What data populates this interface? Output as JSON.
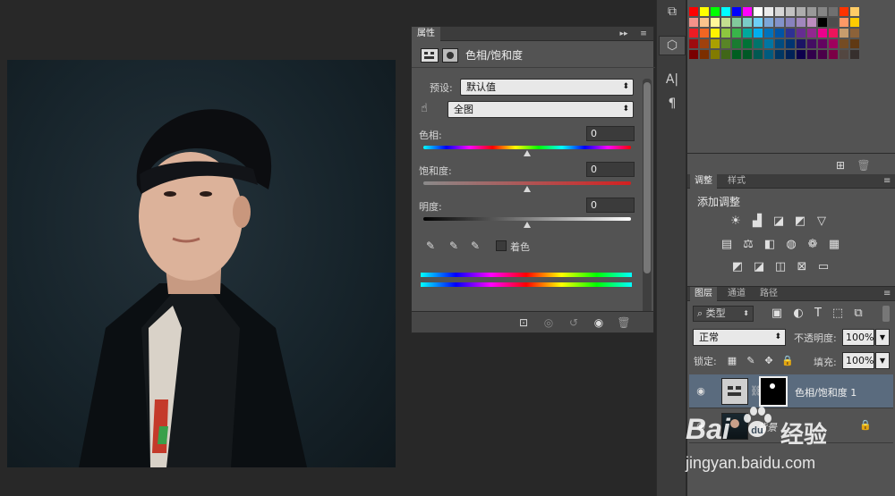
{
  "properties_panel": {
    "tab_label": "属性",
    "menu_collapse": "▸▸",
    "menu_options": "≡",
    "adjustment_title": "色相/饱和度",
    "preset_label": "预设:",
    "preset_value": "默认值",
    "range_value": "全图",
    "hue_label": "色相:",
    "hue_value": "0",
    "saturation_label": "饱和度:",
    "saturation_value": "0",
    "lightness_label": "明度:",
    "lightness_value": "0",
    "colorize_label": "着色",
    "colorize_checked": false,
    "hue_level": 0.5,
    "saturation_level": 0.5,
    "lightness_level": 0.5
  },
  "swatches_panel": {
    "rows": [
      [
        "#ff0000",
        "#ffff00",
        "#00ff00",
        "#00ffff",
        "#0000ff",
        "#ff00ff",
        "#ffffff",
        "#ebebeb",
        "#d6d6d6",
        "#c2c2c2",
        "#adadad",
        "#999999",
        "#858585",
        "#707070",
        "#ff3300",
        "#ffcc66"
      ],
      [
        "#f5928a",
        "#fbc48d",
        "#fff799",
        "#c3df8f",
        "#82ca9c",
        "#7accc8",
        "#6dcff6",
        "#7da7d9",
        "#8393ca",
        "#8882be",
        "#a187be",
        "#bd8cbf",
        "#000000",
        "#4d4d4d",
        "#ff9966",
        "#ffcc00"
      ],
      [
        "#ed1c24",
        "#f26522",
        "#fff200",
        "#8dc63f",
        "#39b54a",
        "#00a99d",
        "#00aeef",
        "#0072bc",
        "#0054a6",
        "#2e3192",
        "#662d91",
        "#92278f",
        "#ec008c",
        "#ed145b",
        "#c69c6d",
        "#8c6239"
      ],
      [
        "#9e0b0f",
        "#a0410d",
        "#aba000",
        "#598527",
        "#197b30",
        "#007236",
        "#00746b",
        "#0076a3",
        "#004b80",
        "#003471",
        "#1b1464",
        "#440e62",
        "#630460",
        "#9e005d",
        "#754c24",
        "#603913"
      ],
      [
        "#790000",
        "#7b2e00",
        "#827b00",
        "#406618",
        "#005e20",
        "#005826",
        "#005952",
        "#005b7f",
        "#003663",
        "#002157",
        "#0d004c",
        "#32004b",
        "#4b0049",
        "#7b0046",
        "#534741",
        "#362f2d"
      ]
    ]
  },
  "adjustments_panel": {
    "tab_adjustments": "调整",
    "tab_styles": "样式",
    "add_adjustment_label": "添加调整"
  },
  "layers_panel": {
    "tab_layers": "图层",
    "tab_channels": "通道",
    "tab_paths": "路径",
    "filter_kind": "类型",
    "blend_mode": "正常",
    "opacity_label": "不透明度:",
    "opacity_value": "100%",
    "lock_label": "锁定:",
    "fill_label": "填充:",
    "fill_value": "100%",
    "layers": [
      {
        "name": "色相/饱和度 1",
        "selected": true
      },
      {
        "name": "背景",
        "selected": false
      }
    ]
  },
  "watermark": {
    "brand": "Bai",
    "paw": "du",
    "jingyan": "经验",
    "url": "jingyan.baidu.com"
  },
  "colors": {
    "panel_bg": "#535353",
    "dark_bar": "#3c3c3c",
    "selected_layer": "#5a6b7e",
    "canvas_bg": "#282828"
  }
}
